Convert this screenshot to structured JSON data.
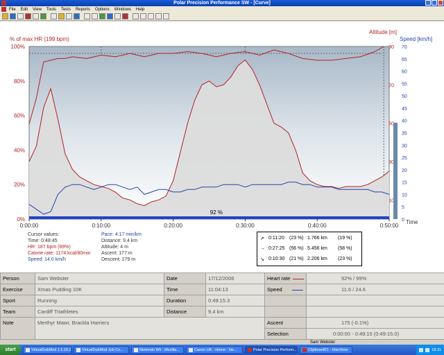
{
  "window": {
    "title": "Polar Precision Performance SW - [Curve]"
  },
  "menu": [
    "File",
    "Edit",
    "View",
    "Tools",
    "Tests",
    "Reports",
    "Options",
    "Windows",
    "Help"
  ],
  "chart_data": {
    "type": "line",
    "title": "",
    "xlabel": "Time",
    "xlim": [
      "0:00:00",
      "0:50:00"
    ],
    "x_ticks": [
      "0:00:00",
      "0:10:00",
      "0:20:00",
      "0:30:00",
      "0:40:00",
      "0:50:00"
    ],
    "axes": {
      "left": {
        "label": "% of max HR (199 bpm)",
        "range": [
          0,
          100
        ],
        "ticks": [
          "0%",
          "20%",
          "40%",
          "60%",
          "80%",
          "100%"
        ]
      },
      "right_altitude": {
        "label": "Altitude [m]",
        "range": [
          0,
          90
        ],
        "ticks": [
          "10",
          "30",
          "50",
          "70",
          "90"
        ]
      },
      "right_speed": {
        "label": "Speed [km/h]",
        "range": [
          0,
          70
        ],
        "ticks": [
          "0",
          "5",
          "10",
          "15",
          "20",
          "25",
          "30",
          "35",
          "40",
          "45",
          "50",
          "55",
          "60",
          "65",
          "70"
        ]
      }
    },
    "grid": false,
    "annotation": "92 %",
    "series": [
      {
        "name": "Heart rate",
        "axis": "left",
        "color": "#b22222",
        "x_min": [
          0,
          1,
          2,
          3,
          4,
          5,
          6,
          8,
          10,
          12,
          14,
          16,
          18,
          20,
          22,
          24,
          26,
          28,
          30,
          32,
          34,
          36,
          38,
          40,
          42,
          44,
          46,
          48,
          49.25
        ],
        "y": [
          55,
          70,
          91,
          92,
          93,
          93,
          94,
          93,
          95,
          94,
          96,
          94,
          96,
          96,
          97,
          96,
          94,
          96,
          97,
          95,
          98,
          96,
          93,
          92,
          92,
          93,
          94,
          97,
          100
        ]
      },
      {
        "name": "Altitude",
        "axis": "right_altitude",
        "color": "#b22222",
        "fill": "#dcdcdc",
        "x_min": [
          0,
          1,
          2,
          3,
          4,
          5,
          6,
          7,
          8,
          9,
          10,
          11,
          12,
          13,
          14,
          15,
          16,
          17,
          18,
          19,
          20,
          21,
          22,
          23,
          24,
          25,
          26,
          27,
          28,
          29,
          30,
          31,
          32,
          33,
          34,
          35,
          36,
          37,
          38,
          39,
          40,
          41,
          42,
          43,
          44,
          45,
          46,
          47,
          48,
          49,
          50
        ],
        "y": [
          30,
          38,
          58,
          68,
          52,
          34,
          26,
          22,
          20,
          18,
          17,
          16,
          14,
          11,
          10,
          8,
          7,
          9,
          10,
          12,
          20,
          35,
          50,
          62,
          70,
          72,
          69,
          70,
          74,
          80,
          83,
          78,
          70,
          60,
          50,
          48,
          45,
          36,
          24,
          20,
          18,
          17,
          17,
          16,
          17,
          17,
          17,
          18,
          20,
          22,
          25
        ]
      },
      {
        "name": "Speed",
        "axis": "right_speed",
        "color": "#2244aa",
        "x_min": [
          0,
          1,
          2,
          3,
          4,
          5,
          6,
          7,
          8,
          9,
          10,
          11,
          12,
          13,
          14,
          15,
          16,
          17,
          18,
          19,
          20,
          21,
          22,
          23,
          24,
          25,
          26,
          27,
          28,
          29,
          30,
          31,
          32,
          33,
          34,
          35,
          36,
          37,
          38,
          39,
          40,
          41,
          42,
          43,
          44,
          45,
          46,
          47,
          48,
          49,
          50
        ],
        "y": [
          6,
          4,
          2,
          3,
          10,
          13,
          14,
          14,
          13,
          12,
          13,
          14,
          14,
          13,
          12,
          13,
          10,
          11,
          12,
          12,
          11,
          11,
          12,
          12,
          13,
          13,
          13,
          14,
          14,
          14,
          13,
          14,
          14,
          14,
          14,
          14,
          15,
          15,
          14,
          14,
          13,
          13,
          13,
          12,
          12,
          12,
          12,
          12,
          11,
          11,
          10
        ]
      }
    ]
  },
  "cursor": {
    "heading": "Cursor values:",
    "time": "Time: 0:48:45",
    "hr": "HR: 187 bpm (89%)",
    "calorie": "Calorie rate: 1174 kcal/80min",
    "speed": "Speed: 14.0 km/h",
    "pace": "Pace: 4:17 min/km",
    "distance": "Distance: 9.4 km",
    "altitude": "Altitude: 4 m",
    "ascent": "Ascent: 177 m",
    "descent": "Descent: 179 m"
  },
  "slopes": [
    {
      "arrow": "↗",
      "time": "0:11:20",
      "pct": "(23 %)",
      "dist": "1.766 km",
      "dpct": "(19 %)"
    },
    {
      "arrow": "→",
      "time": "0:27:25",
      "pct": "(56 %)",
      "dist": "5.456 km",
      "dpct": "(58 %)"
    },
    {
      "arrow": "↘",
      "time": "0:10:30",
      "pct": "(21 %)",
      "dist": "2.206 km",
      "dpct": "(23 %)"
    }
  ],
  "info": {
    "person": {
      "label": "Person",
      "value": "Sam Webster"
    },
    "date": {
      "label": "Date",
      "value": "17/12/2006"
    },
    "heart_rate": {
      "label": "Heart rate",
      "value": "92% / 99%"
    },
    "exercise": {
      "label": "Exercise",
      "value": "Xmas Pudding 10K"
    },
    "time": {
      "label": "Time",
      "value": "11:04:13"
    },
    "speed": {
      "label": "Speed",
      "value": "11.6 / 24.6"
    },
    "sport": {
      "label": "Sport",
      "value": "Running"
    },
    "duration": {
      "label": "Duration",
      "value": "0:49:15.3"
    },
    "team": {
      "label": "Team",
      "value": "Cardiff Triathletes"
    },
    "distance": {
      "label": "Distance",
      "value": "9.4 km"
    },
    "note": {
      "label": "Note",
      "value": "Merthyr Mawr, Brackla Harriers"
    },
    "ascent": {
      "label": "Ascent",
      "value": "175 (-0.1%)"
    },
    "selection": {
      "label": "Selection",
      "value": "0:00:00 - 0:49:15 (0:49:15.0)"
    }
  },
  "colors": {
    "hr_line": "#b22222",
    "speed_line": "#2244aa",
    "plot_bg": "#d8e0e8",
    "fill": "#dcdcdc"
  },
  "taskbar": {
    "start": "start",
    "user": "Sam Webster",
    "buttons": [
      "VirtualDubMod 1.5.10.2",
      "VirtualDubMod Job Co...",
      "Nintendo Wii - Mozilla...",
      "Canon UK - Home - Ne...",
      "Polar Precision Perform...",
      "Clipboard01 - IrfanView"
    ],
    "clock": "18:31"
  }
}
